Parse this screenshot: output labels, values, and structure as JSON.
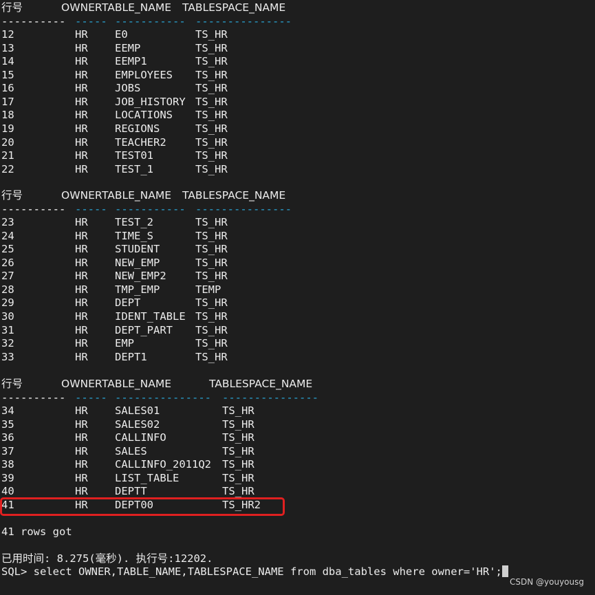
{
  "blocks": [
    {
      "headers": [
        "行号",
        "OWNER",
        "TABLE_NAME",
        "TABLESPACE_NAME"
      ],
      "dashes": [
        "----------",
        "-----",
        "-----------",
        "---------------"
      ],
      "rows": [
        [
          "12",
          "HR",
          "E0",
          "TS_HR"
        ],
        [
          "13",
          "HR",
          "EEMP",
          "TS_HR"
        ],
        [
          "14",
          "HR",
          "EEMP1",
          "TS_HR"
        ],
        [
          "15",
          "HR",
          "EMPLOYEES",
          "TS_HR"
        ],
        [
          "16",
          "HR",
          "JOBS",
          "TS_HR"
        ],
        [
          "17",
          "HR",
          "JOB_HISTORY",
          "TS_HR"
        ],
        [
          "18",
          "HR",
          "LOCATIONS",
          "TS_HR"
        ],
        [
          "19",
          "HR",
          "REGIONS",
          "TS_HR"
        ],
        [
          "20",
          "HR",
          "TEACHER2",
          "TS_HR"
        ],
        [
          "21",
          "HR",
          "TEST01",
          "TS_HR"
        ],
        [
          "22",
          "HR",
          "TEST_1",
          "TS_HR"
        ]
      ]
    },
    {
      "headers": [
        "行号",
        "OWNER",
        "TABLE_NAME",
        "TABLESPACE_NAME"
      ],
      "dashes": [
        "----------",
        "-----",
        "-----------",
        "---------------"
      ],
      "rows": [
        [
          "23",
          "HR",
          "TEST_2",
          "TS_HR"
        ],
        [
          "24",
          "HR",
          "TIME_S",
          "TS_HR"
        ],
        [
          "25",
          "HR",
          "STUDENT",
          "TS_HR"
        ],
        [
          "26",
          "HR",
          "NEW_EMP",
          "TS_HR"
        ],
        [
          "27",
          "HR",
          "NEW_EMP2",
          "TS_HR"
        ],
        [
          "28",
          "HR",
          "TMP_EMP",
          "TEMP"
        ],
        [
          "29",
          "HR",
          "DEPT",
          "TS_HR"
        ],
        [
          "30",
          "HR",
          "IDENT_TABLE",
          "TS_HR"
        ],
        [
          "31",
          "HR",
          "DEPT_PART",
          "TS_HR"
        ],
        [
          "32",
          "HR",
          "EMP",
          "TS_HR"
        ],
        [
          "33",
          "HR",
          "DEPT1",
          "TS_HR"
        ]
      ]
    },
    {
      "headers": [
        "行号",
        "OWNER",
        "TABLE_NAME",
        "TABLESPACE_NAME"
      ],
      "dashes": [
        "----------",
        "-----",
        "---------------",
        "---------------"
      ],
      "rows": [
        [
          "34",
          "HR",
          "SALES01",
          "TS_HR"
        ],
        [
          "35",
          "HR",
          "SALES02",
          "TS_HR"
        ],
        [
          "36",
          "HR",
          "CALLINFO",
          "TS_HR"
        ],
        [
          "37",
          "HR",
          "SALES",
          "TS_HR"
        ],
        [
          "38",
          "HR",
          "CALLINFO_2011Q2",
          "TS_HR"
        ],
        [
          "39",
          "HR",
          "LIST_TABLE",
          "TS_HR"
        ],
        [
          "40",
          "HR",
          "DEPTT",
          "TS_HR"
        ],
        [
          "41",
          "HR",
          "DEPT00",
          "TS_HR2"
        ]
      ]
    }
  ],
  "summary": "41 rows got",
  "elapsed": "已用时间: 8.275(毫秒). 执行号:12202.",
  "prompt": "SQL> ",
  "command": "select OWNER,TABLE_NAME,TABLESPACE_NAME from dba_tables where owner='HR';",
  "watermark": "CSDN @youyousg",
  "colors": {
    "background": "#1e1e1e",
    "text": "#ececec",
    "dash_accent": "#2aa7d8",
    "highlight": "#e02020"
  }
}
